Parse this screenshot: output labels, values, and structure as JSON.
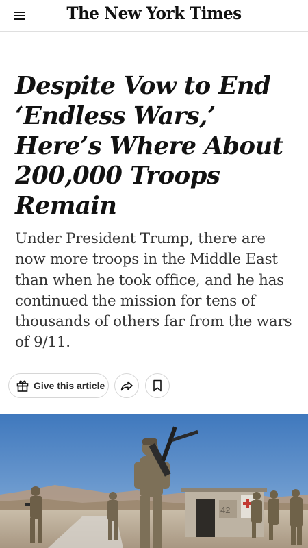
{
  "header": {
    "logo_text": "The New York Times",
    "menu_icon": "hamburger-menu-icon"
  },
  "article": {
    "headline": "Despite Vow to End ‘Endless Wars,’ Here’s Where About 200,000 Troops Remain",
    "summary": "Under President Trump, there are now more troops in the Middle East than when he took office, and he has continued the mission for tens of thousands of others far from the wars of 9/11."
  },
  "actions": {
    "gift_label": "Give this article",
    "gift_icon": "gift-icon",
    "share_icon": "share-arrow-icon",
    "save_icon": "bookmark-icon"
  },
  "photo": {
    "subject": "soldiers-photo",
    "building_number": "42",
    "colors": {
      "sky": "#4f86c6",
      "ground": "#b8aa98",
      "uniform": "#7a6e55"
    }
  }
}
